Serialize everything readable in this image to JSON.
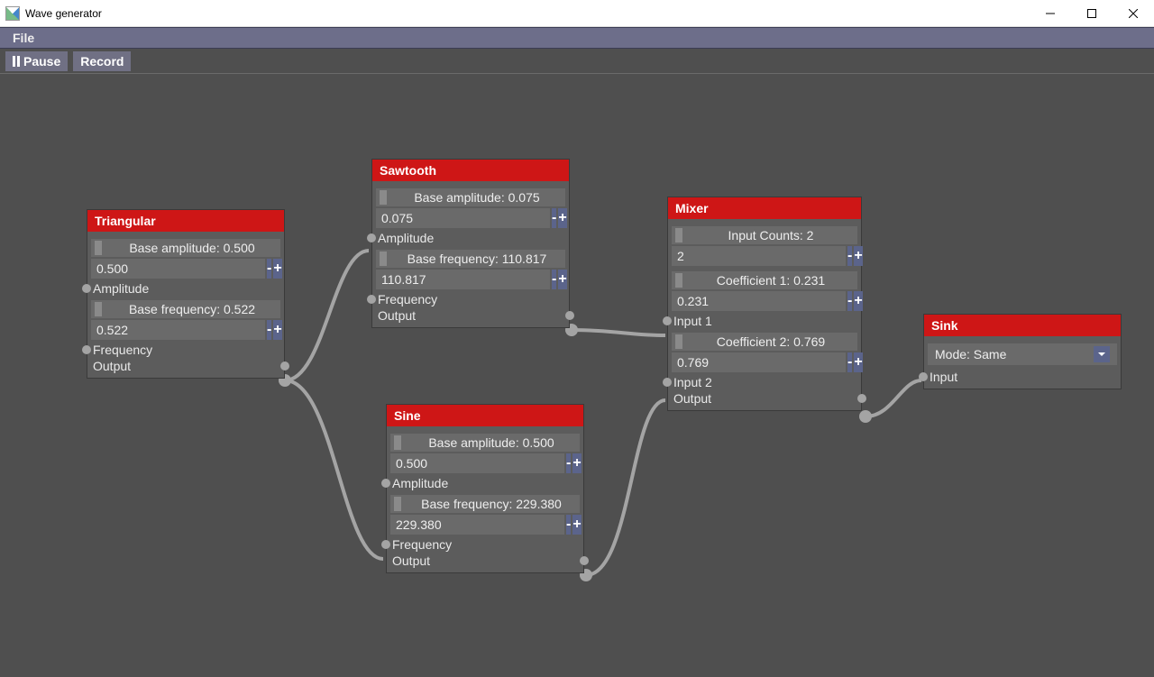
{
  "window": {
    "title": "Wave generator"
  },
  "menubar": {
    "file": "File"
  },
  "toolbar": {
    "pause": "Pause",
    "record": "Record"
  },
  "nodes": {
    "triangular": {
      "title": "Triangular",
      "base_amp_label": "Base amplitude: 0.500",
      "base_amp_value": "0.500",
      "amplitude_port": "Amplitude",
      "base_freq_label": "Base frequency: 0.522",
      "base_freq_value": "0.522",
      "frequency_port": "Frequency",
      "output_port": "Output"
    },
    "sawtooth": {
      "title": "Sawtooth",
      "base_amp_label": "Base amplitude: 0.075",
      "base_amp_value": "0.075",
      "amplitude_port": "Amplitude",
      "base_freq_label": "Base frequency: 110.817",
      "base_freq_value": "110.817",
      "frequency_port": "Frequency",
      "output_port": "Output"
    },
    "sine": {
      "title": "Sine",
      "base_amp_label": "Base amplitude: 0.500",
      "base_amp_value": "0.500",
      "amplitude_port": "Amplitude",
      "base_freq_label": "Base frequency: 229.380",
      "base_freq_value": "229.380",
      "frequency_port": "Frequency",
      "output_port": "Output"
    },
    "mixer": {
      "title": "Mixer",
      "input_counts_label": "Input Counts: 2",
      "input_counts_value": "2",
      "coef1_label": "Coefficient 1: 0.231",
      "coef1_value": "0.231",
      "input1_port": "Input 1",
      "coef2_label": "Coefficient 2: 0.769",
      "coef2_value": "0.769",
      "input2_port": "Input 2",
      "output_port": "Output"
    },
    "sink": {
      "title": "Sink",
      "mode_label": "Mode: Same",
      "input_port": "Input"
    }
  },
  "glyphs": {
    "minus": "-",
    "plus": "+"
  }
}
